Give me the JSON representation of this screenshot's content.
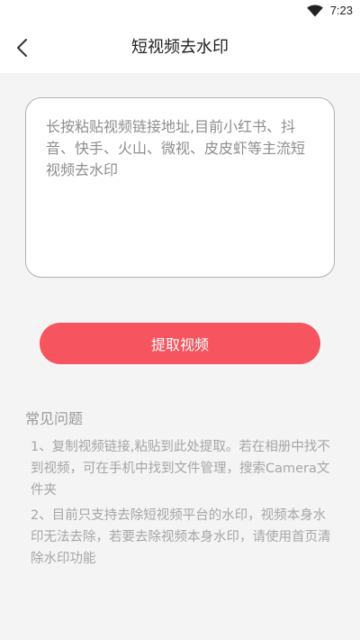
{
  "status_bar": {
    "time": "7:23",
    "icons": [
      "wifi-icon"
    ]
  },
  "app_bar": {
    "back_icon": "chevron-left-icon",
    "title": "短视频去水印"
  },
  "link_input": {
    "placeholder": "长按粘贴视频链接地址,目前小红书、抖音、快手、火山、微视、皮皮虾等主流短视频去水印",
    "value": ""
  },
  "extract_button": {
    "label": "提取视频",
    "color": "#f6545f"
  },
  "faq": {
    "title": "常见问题",
    "items": [
      "1、复制视频链接,粘贴到此处提取。若在相册中找不到视频，可在手机中找到文件管理，搜索Camera文件夹",
      "2、目前只支持去除短视频平台的水印，视频本身水印无法去除，若要去除视频本身水印，请使用首页清除水印功能"
    ]
  },
  "colors": {
    "content_background": "#f5f4f4",
    "accent": "#f6545f"
  }
}
